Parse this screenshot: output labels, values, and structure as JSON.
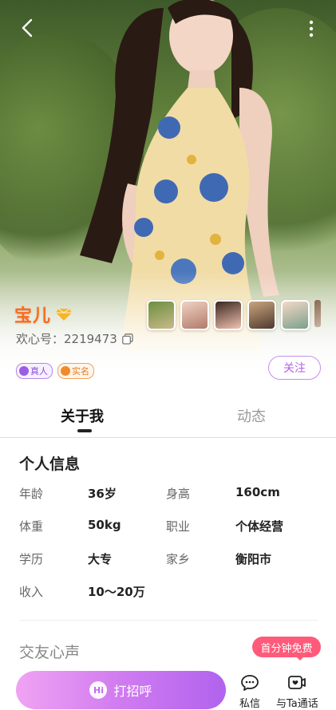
{
  "header": {
    "back_icon": "chevron-left-icon",
    "more_icon": "vertical-dots-icon"
  },
  "profile": {
    "name": "宝儿",
    "level_icon": "diamond-icon",
    "uid_text": "欢心号：2219473",
    "copy_icon": "copy-icon",
    "badges": [
      {
        "label": "真人",
        "icon": "person-icon",
        "color": "#8b4fd8"
      },
      {
        "label": "实名",
        "icon": "id-icon",
        "color": "#e27b1c"
      }
    ],
    "follow_label": "关注"
  },
  "tabs": [
    {
      "label": "关于我",
      "active": true
    },
    {
      "label": "动态",
      "active": false
    }
  ],
  "personal_info": {
    "title": "个人信息",
    "rows": [
      {
        "label1": "年龄",
        "value1": "36岁",
        "label2": "身高",
        "value2": "160cm"
      },
      {
        "label1": "体重",
        "value1": "50kg",
        "label2": "职业",
        "value2": "个体经营"
      },
      {
        "label1": "学历",
        "value1": "大专",
        "label2": "家乡",
        "value2": "衡阳市"
      },
      {
        "label1": "收入",
        "value1": "10～20万",
        "label2": "",
        "value2": ""
      }
    ]
  },
  "friendship": {
    "title": "交友心声"
  },
  "promo": {
    "label": "首分钟免费"
  },
  "bottom_bar": {
    "greet_label": "打招呼",
    "greet_icon_text": "Hi",
    "message_label": "私信",
    "call_label": "与Ta通话"
  },
  "colors": {
    "accent_purple": "#b163ee",
    "name_orange": "#ff6a1a",
    "promo_pink": "#ff5a7a"
  }
}
